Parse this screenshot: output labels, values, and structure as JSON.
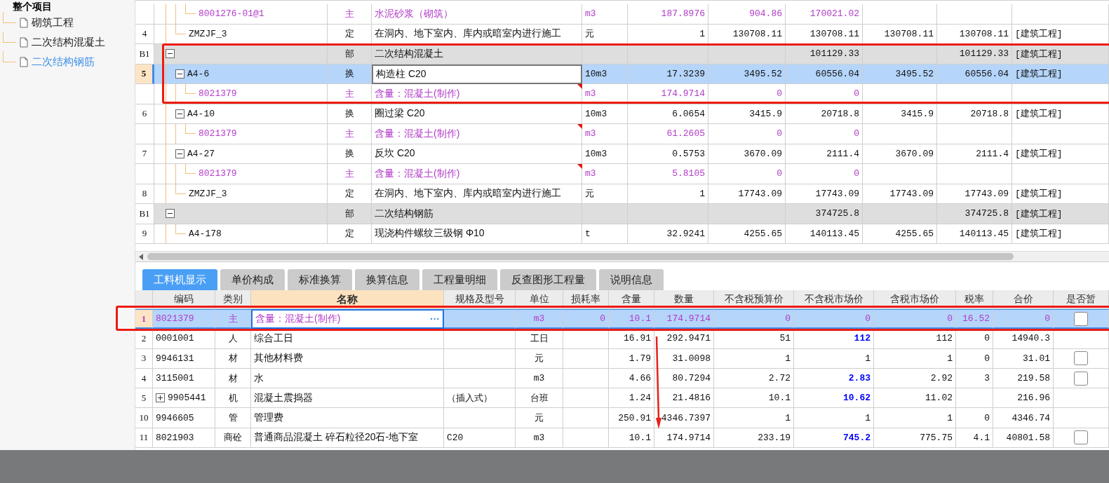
{
  "sidebar": {
    "root": {
      "label": "整个项目",
      "children": [
        {
          "label": "砌筑工程",
          "selected": false
        },
        {
          "label": "二次结构混凝土",
          "selected": false
        },
        {
          "label": "二次结构钢筋",
          "selected": true
        }
      ]
    }
  },
  "top_table": {
    "groups": [
      {
        "items": [
          {
            "children": [
              {
                "kind": "material",
                "cells": [
                  null,
                  "8001276-01@1",
                  "主",
                  "水泥砂浆（砌筑）",
                  "m3",
                  "187.8976",
                  "904.86",
                  "170021.02",
                  null,
                  null,
                  null
                ]
              }
            ]
          },
          {
            "kind": "item",
            "selected": false,
            "cells": [
              "4",
              "ZMZJF_3",
              "定",
              "在洞内、地下室内、库内或暗室内进行施工",
              "元",
              "1",
              "130708.11",
              "130708.11",
              "130708.11",
              "130708.11",
              "[建筑工程]"
            ]
          }
        ]
      },
      {
        "header": {
          "expanded": true,
          "cells": [
            "B1",
            null,
            "部",
            "二次结构混凝土",
            null,
            null,
            null,
            "101129.33",
            null,
            "101129.33",
            "[建筑工程]"
          ]
        },
        "items": [
          {
            "kind": "item",
            "selected": true,
            "expanded": true,
            "cells": [
              "5",
              "A4-6",
              "换",
              "构造柱 C20",
              "10m3",
              "17.3239",
              "3495.52",
              "60556.04",
              "3495.52",
              "60556.04",
              "[建筑工程]"
            ],
            "children": [
              {
                "kind": "material",
                "flagged": true,
                "cells": [
                  null,
                  "8021379",
                  "主",
                  "含量：混凝土(制作)",
                  "m3",
                  "174.9714",
                  "0",
                  "0",
                  null,
                  null,
                  null
                ]
              }
            ]
          },
          {
            "kind": "item",
            "selected": false,
            "expanded": true,
            "cells": [
              "6",
              "A4-10",
              "换",
              "圈过梁 C20",
              "10m3",
              "6.0654",
              "3415.9",
              "20718.8",
              "3415.9",
              "20718.8",
              "[建筑工程]"
            ],
            "children": [
              {
                "kind": "material",
                "flagged": true,
                "cells": [
                  null,
                  "8021379",
                  "主",
                  "含量：混凝土(制作)",
                  "m3",
                  "61.2605",
                  "0",
                  "0",
                  null,
                  null,
                  null
                ]
              }
            ]
          },
          {
            "kind": "item",
            "selected": false,
            "expanded": true,
            "cells": [
              "7",
              "A4-27",
              "换",
              "反坎 C20",
              "10m3",
              "0.5753",
              "3670.09",
              "2111.4",
              "3670.09",
              "2111.4",
              "[建筑工程]"
            ],
            "children": [
              {
                "kind": "material",
                "flagged": true,
                "cells": [
                  null,
                  "8021379",
                  "主",
                  "含量：混凝土(制作)",
                  "m3",
                  "5.8105",
                  "0",
                  "0",
                  null,
                  null,
                  null
                ]
              }
            ]
          },
          {
            "kind": "item",
            "selected": false,
            "cells": [
              "8",
              "ZMZJF_3",
              "定",
              "在洞内、地下室内、库内或暗室内进行施工",
              "元",
              "1",
              "17743.09",
              "17743.09",
              "17743.09",
              "17743.09",
              "[建筑工程]"
            ]
          }
        ]
      },
      {
        "header": {
          "expanded": true,
          "cells": [
            "B1",
            null,
            "部",
            "二次结构钢筋",
            null,
            null,
            null,
            "374725.8",
            null,
            "374725.8",
            "[建筑工程]"
          ]
        },
        "items": [
          {
            "kind": "item",
            "selected": false,
            "cells": [
              "9",
              "A4-178",
              "定",
              "现浇构件螺纹三级钢 Φ10",
              "t",
              "32.9241",
              "4255.65",
              "140113.45",
              "4255.65",
              "140113.45",
              "[建筑工程]"
            ]
          }
        ]
      }
    ]
  },
  "detail_tabs": [
    {
      "label": "工料机显示",
      "selected": true
    },
    {
      "label": "单价构成",
      "selected": false
    },
    {
      "label": "标准换算",
      "selected": false
    },
    {
      "label": "换算信息",
      "selected": false
    },
    {
      "label": "工程量明细",
      "selected": false
    },
    {
      "label": "反查图形工程量",
      "selected": false
    },
    {
      "label": "说明信息",
      "selected": false
    }
  ],
  "detail_table": {
    "edit_button": "···",
    "columns": [
      {
        "label": "编码",
        "highlighted": false
      },
      {
        "label": "类别",
        "highlighted": false
      },
      {
        "label": "名称",
        "highlighted": true
      },
      {
        "label": "规格及型号",
        "highlighted": false
      },
      {
        "label": "单位",
        "highlighted": false
      },
      {
        "label": "损耗率",
        "highlighted": false
      },
      {
        "label": "含量",
        "highlighted": false
      },
      {
        "label": "数量",
        "highlighted": false
      },
      {
        "label": "不含税预算价",
        "highlighted": false
      },
      {
        "label": "不含税市场价",
        "highlighted": false
      },
      {
        "label": "含税市场价",
        "highlighted": false
      },
      {
        "label": "税率",
        "highlighted": false
      },
      {
        "label": "合价",
        "highlighted": false
      },
      {
        "label": "是否暂",
        "highlighted": false
      }
    ],
    "rows": [
      {
        "row_no": "1",
        "kind": "material",
        "selected": true,
        "price_adjusted": false,
        "estimated": false,
        "cells": [
          "8021379",
          "主",
          "含量：混凝土(制作)",
          null,
          "m3",
          "0",
          "10.1",
          "174.9714",
          "0",
          "0",
          "0",
          "16.52",
          "0"
        ]
      },
      {
        "row_no": "2",
        "kind": "resource",
        "selected": false,
        "price_adjusted": true,
        "cells": [
          "0001001",
          "人",
          "综合工日",
          null,
          "工日",
          null,
          "16.91",
          "292.9471",
          "51",
          "112",
          "112",
          "0",
          "14940.3"
        ]
      },
      {
        "row_no": "3",
        "kind": "resource",
        "selected": false,
        "price_adjusted": false,
        "estimated": false,
        "cells": [
          "9946131",
          "材",
          "其他材料费",
          null,
          "元",
          null,
          "1.79",
          "31.0098",
          "1",
          "1",
          "1",
          "0",
          "31.01"
        ]
      },
      {
        "row_no": "4",
        "kind": "resource",
        "selected": false,
        "price_adjusted": true,
        "estimated": false,
        "cells": [
          "3115001",
          "材",
          "水",
          null,
          "m3",
          null,
          "4.66",
          "80.7294",
          "2.72",
          "2.83",
          "2.92",
          "3",
          "219.58"
        ]
      },
      {
        "row_no": "5",
        "kind": "resource",
        "selected": false,
        "price_adjusted": true,
        "expanded": false,
        "cells": [
          "9905441",
          "机",
          "混凝土震捣器",
          "（插入式）",
          "台班",
          null,
          "1.24",
          "21.4816",
          "10.1",
          "10.62",
          "11.02",
          null,
          "216.96"
        ]
      },
      {
        "row_no": "10",
        "kind": "resource",
        "selected": false,
        "price_adjusted": false,
        "cells": [
          "9946605",
          "管",
          "管理费",
          null,
          "元",
          null,
          "250.91",
          "4346.7397",
          "1",
          "1",
          "1",
          "0",
          "4346.74"
        ]
      },
      {
        "row_no": "11",
        "kind": "resource",
        "selected": false,
        "price_adjusted": true,
        "estimated": false,
        "cells": [
          "8021903",
          "商砼",
          "普通商品混凝土 碎石粒径20石-地下室",
          "C20",
          "m3",
          null,
          "10.1",
          "174.9714",
          "233.19",
          "745.2",
          "775.75",
          "4.1",
          "40801.58"
        ]
      }
    ]
  }
}
